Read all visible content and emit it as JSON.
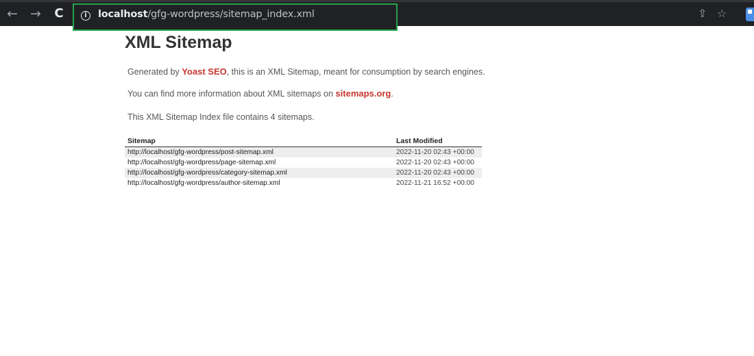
{
  "browser": {
    "url_host": "localhost",
    "url_path": "/gfg-wordpress/sitemap_index.xml",
    "back_icon": "←",
    "forward_icon": "→",
    "reload_icon": "C",
    "info_icon": "i",
    "share_icon": "⇪",
    "star_icon": "☆",
    "accent_color": "#22a34a"
  },
  "page": {
    "title": "XML Sitemap",
    "intro_prefix": "Generated by ",
    "intro_link": "Yoast SEO",
    "intro_suffix": ", this is an XML Sitemap, meant for consumption by search engines.",
    "info_prefix": "You can find more information about XML sitemaps on ",
    "info_link": "sitemaps.org",
    "info_suffix": ".",
    "count_text": "This XML Sitemap Index file contains 4 sitemaps.",
    "link_color": "#c7372f"
  },
  "table": {
    "headers": [
      "Sitemap",
      "Last Modified"
    ],
    "rows": [
      {
        "url": "http://localhost/gfg-wordpress/post-sitemap.xml",
        "modified": "2022-11-20 02:43 +00:00"
      },
      {
        "url": "http://localhost/gfg-wordpress/page-sitemap.xml",
        "modified": "2022-11-20 02:43 +00:00"
      },
      {
        "url": "http://localhost/gfg-wordpress/category-sitemap.xml",
        "modified": "2022-11-20 02:43 +00:00"
      },
      {
        "url": "http://localhost/gfg-wordpress/author-sitemap.xml",
        "modified": "2022-11-21 16:52 +00:00"
      }
    ]
  }
}
